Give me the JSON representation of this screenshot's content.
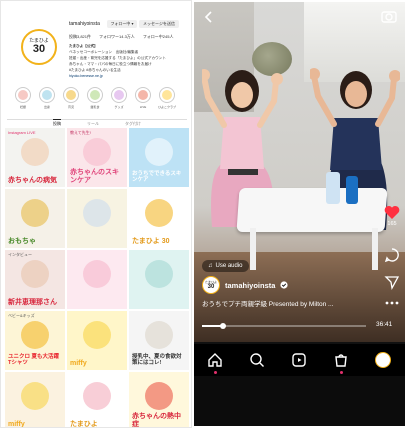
{
  "profile": {
    "username": "tamahiyoinsta",
    "avatar_line1": "たまひよ",
    "avatar_line2": "30",
    "follow_button": "フォロー中 ▾",
    "message_button": "メッセージを送信",
    "stats": [
      "投稿3,821件",
      "フォロワー14.3万人",
      "フォロー中245人"
    ],
    "bio": [
      "たまひよ【公式】",
      "ベネッセコーポレーション　出版社/編集者",
      "妊娠・出産・育児を応援する「たまひよ」の公式アカウント",
      "赤ちゃん・ママ・パパの毎日に役立つ情報をお届け",
      "#たまひよ #赤ちゃんのいる生活",
      "hiyoko.benesse.ne.jp"
    ],
    "highlights": [
      {
        "label": "妊娠",
        "color": "#f6c9c4"
      },
      {
        "label": "出産",
        "color": "#bfe3f0"
      },
      {
        "label": "育児",
        "color": "#f7d98c"
      },
      {
        "label": "離乳食",
        "color": "#cfe8b8"
      },
      {
        "label": "グッズ",
        "color": "#e7c8f0"
      },
      {
        "label": "LIVE",
        "color": "#f4b6a9"
      },
      {
        "label": "ひよこクラブ",
        "color": "#ffe59a"
      }
    ],
    "tabs": [
      "投稿",
      "リール",
      "タグ付け"
    ]
  },
  "grid_tiles": [
    {
      "bg": "#f3f3f0",
      "cap": "赤ちゃんの病気",
      "cap_color": "#d8263c",
      "sub": "Instagram LIVE",
      "sub_color": "#e1306c"
    },
    {
      "bg": "#fbe6ea",
      "cap": "赤ちゃんのスキンケア",
      "cap_color": "#e0457b",
      "sub": "教えて先生!",
      "sub_color": "#c03060"
    },
    {
      "bg": "#bde2f5",
      "cap": "おうちでできるスキンケア",
      "cap_color": "#ffffff",
      "sub": "",
      "sub_color": "#ffffff"
    },
    {
      "bg": "#f5f1e8",
      "cap": "おもちゃ",
      "cap_color": "#4a8a2b",
      "sub": "",
      "sub_color": "#333"
    },
    {
      "bg": "#f7f3e2",
      "cap": "",
      "cap_color": "#333",
      "sub": "",
      "sub_color": "#333"
    },
    {
      "bg": "#ffffff",
      "cap": "たまひよ 30",
      "cap_color": "#e39a1a",
      "sub": "",
      "sub_color": "#333"
    },
    {
      "bg": "#f4e6e3",
      "cap": "新井恵理那さん",
      "cap_color": "#d8263c",
      "sub": "インタビュー",
      "sub_color": "#555"
    },
    {
      "bg": "#fde9f0",
      "cap": "",
      "cap_color": "#333",
      "sub": "",
      "sub_color": "#333"
    },
    {
      "bg": "#dff3f1",
      "cap": "",
      "cap_color": "#333",
      "sub": "",
      "sub_color": "#333"
    },
    {
      "bg": "#fdf5d6",
      "cap": "ユニクロ 夏も大活躍 Tシャツ",
      "cap_color": "#e8232d",
      "sub": "ベビー&キッズ",
      "sub_color": "#555"
    },
    {
      "bg": "#fff6c9",
      "cap": "miffy",
      "cap_color": "#f0a81c",
      "sub": "",
      "sub_color": "#333"
    },
    {
      "bg": "#f5f5f5",
      "cap": "授乳中、夏の食欲対策にはコレ!",
      "cap_color": "#333",
      "sub": "",
      "sub_color": "#333"
    },
    {
      "bg": "#fbf2e0",
      "cap": "miffy",
      "cap_color": "#f0a81c",
      "sub": "",
      "sub_color": "#333"
    },
    {
      "bg": "#ffffff",
      "cap": "たまひよ",
      "cap_color": "#e39a1a",
      "sub": "",
      "sub_color": "#333"
    },
    {
      "bg": "#fff8dc",
      "cap": "赤ちゃんの熱中症",
      "cap_color": "#d8263c",
      "sub": "",
      "sub_color": "#333"
    }
  ],
  "reel": {
    "audio_label": "Use audio",
    "avatar_line1": "たまひよ",
    "avatar_line2": "30",
    "handle": "tamahiyoinsta",
    "caption": "おうちでプチ両親学級 Presented by Milton ...",
    "like_count": "165",
    "time": "36:41",
    "progress": 0.13,
    "icons": [
      "back-icon",
      "camera-icon",
      "heart-icon",
      "comment-icon",
      "send-icon",
      "more-icon",
      "music-icon"
    ],
    "nav": [
      "home-icon",
      "search-icon",
      "reels-icon",
      "shop-icon",
      "profile-icon"
    ]
  },
  "colors": {
    "accent": "#e1306c",
    "brand_yellow": "#f2b21a"
  }
}
